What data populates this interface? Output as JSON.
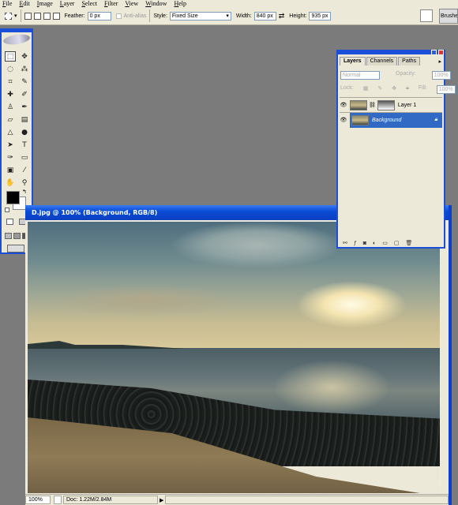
{
  "menu": [
    "File",
    "Edit",
    "Image",
    "Layer",
    "Select",
    "Filter",
    "View",
    "Window",
    "Help"
  ],
  "options": {
    "feather_label": "Feather:",
    "feather_value": "0 px",
    "antialias_label": "Anti-alias",
    "style_label": "Style:",
    "style_value": "Fixed Size",
    "width_label": "Width:",
    "width_value": "840 px",
    "height_label": "Height:",
    "height_value": "935 px",
    "brushes_tab": "Brushes"
  },
  "document": {
    "title": "D.jpg @ 100% (Background, RGB/8)",
    "zoom": "100%",
    "doc_size": "Doc: 1.22M/2.84M"
  },
  "layers_panel": {
    "tabs": [
      "Layers",
      "Channels",
      "Paths"
    ],
    "blend_mode": "Normal",
    "opacity_label": "Opacity:",
    "opacity_value": "100%",
    "lock_label": "Lock:",
    "fill_label": "Fill:",
    "fill_value": "100%",
    "layers": [
      {
        "name": "Layer 1",
        "selected": false
      },
      {
        "name": "Background",
        "selected": true
      }
    ]
  },
  "colors": {
    "accent": "#1b4fd8",
    "selection": "#316ac5"
  }
}
